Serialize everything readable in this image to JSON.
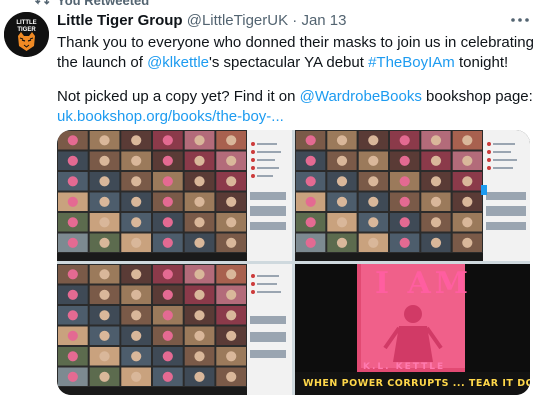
{
  "retweet": {
    "label": "You Retweeted",
    "icon": "retweet-icon"
  },
  "tweet": {
    "author_name": "Little Tiger Group",
    "handle": "@LittleTigerUK",
    "separator": "·",
    "date": "Jan 13",
    "avatar_label": "LITTLE TIGER",
    "more_icon": "more-horizontal-icon",
    "text": {
      "l1": "Thank you to everyone who donned their masks to join us in celebrating",
      "l2_a": "the launch of ",
      "l2_mention": "@klkettle",
      "l2_b": "'s spectacular YA debut ",
      "l2_hashtag": "#TheBoyIAm",
      "l2_c": " tonight!",
      "l3_a": "Not picked up a copy yet? Find it on ",
      "l3_mention": "@WardrobeBooks",
      "l3_b": " bookshop page:",
      "l4_link": "uk.bookshop.org/books/the-boy-..."
    }
  },
  "media": {
    "book": {
      "title": "I AM",
      "author": "K.L. KETTLE",
      "tagline": "WHEN POWER CORRUPTS ... TEAR IT DOWN"
    }
  },
  "colors": {
    "link": "#1d9bf0",
    "muted": "#536471",
    "text": "#0f1419"
  }
}
